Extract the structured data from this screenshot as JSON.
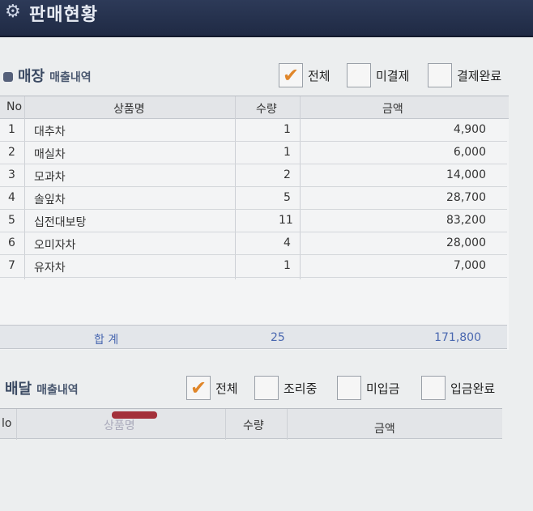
{
  "window": {
    "title": "판매현황",
    "icon": "gear-icon"
  },
  "store": {
    "title": "매장",
    "subtitle": "매출내역",
    "filters": [
      {
        "label": "전체",
        "checked": true
      },
      {
        "label": "미결제",
        "checked": false
      },
      {
        "label": "결제완료",
        "checked": false
      }
    ],
    "columns": [
      "No",
      "상품명",
      "수량",
      "금액"
    ],
    "rows": [
      {
        "no": "1",
        "name": "대추차",
        "qty": "1",
        "amount": "4,900"
      },
      {
        "no": "2",
        "name": "매실차",
        "qty": "1",
        "amount": "6,000"
      },
      {
        "no": "3",
        "name": "모과차",
        "qty": "2",
        "amount": "14,000"
      },
      {
        "no": "4",
        "name": "솔잎차",
        "qty": "5",
        "amount": "28,700"
      },
      {
        "no": "5",
        "name": "십전대보탕",
        "qty": "11",
        "amount": "83,200"
      },
      {
        "no": "6",
        "name": "오미자차",
        "qty": "4",
        "amount": "28,000"
      },
      {
        "no": "7",
        "name": "유자차",
        "qty": "1",
        "amount": "7,000"
      }
    ],
    "total": {
      "label": "합 계",
      "qty": "25",
      "amount": "171,800"
    }
  },
  "delivery": {
    "title": "배달",
    "subtitle": "매출내역",
    "filters": [
      {
        "label": "전체",
        "checked": true
      },
      {
        "label": "조리중",
        "checked": false
      },
      {
        "label": "미입금",
        "checked": false
      },
      {
        "label": "입금완료",
        "checked": false
      }
    ],
    "columns": [
      "lo",
      "상품명",
      "수량",
      "금액"
    ]
  },
  "colors": {
    "titlebar": "#1f2a44",
    "check": "#e0862a",
    "total_text": "#4a68b0"
  }
}
